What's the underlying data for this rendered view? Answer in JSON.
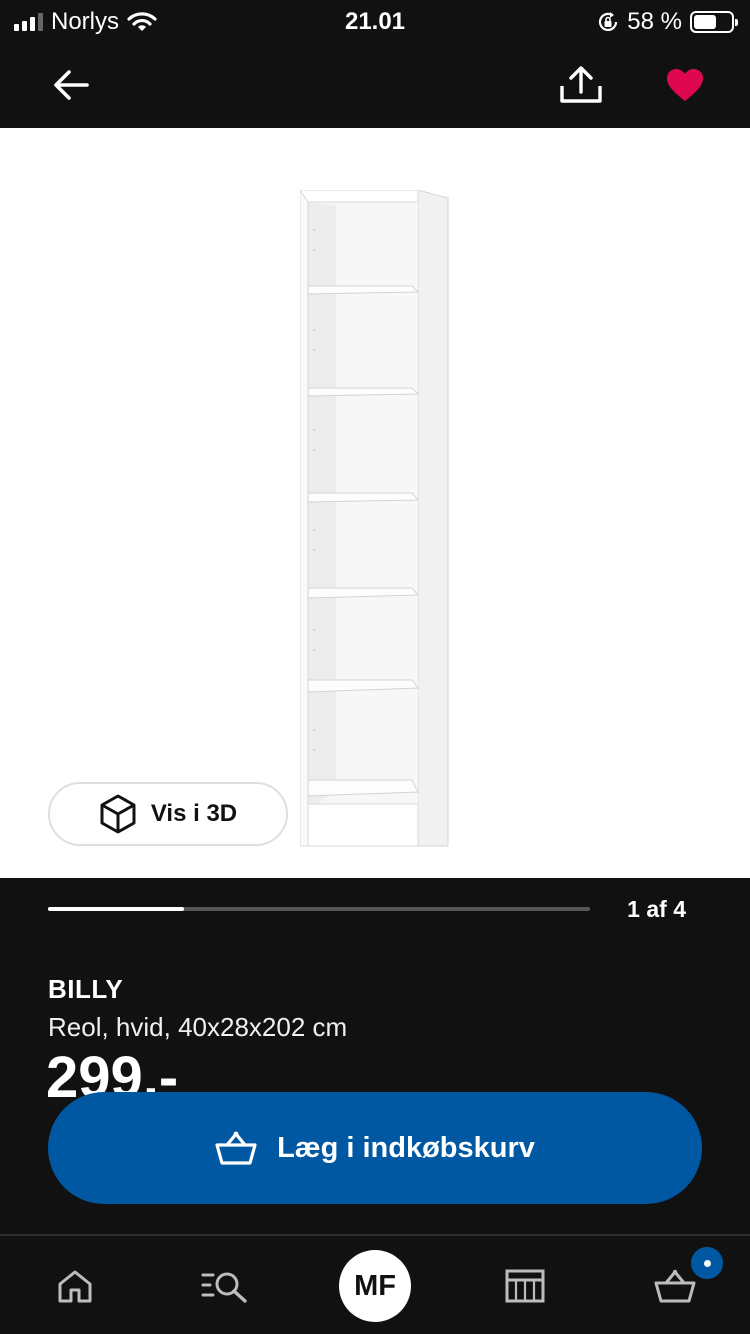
{
  "status_bar": {
    "carrier": "Norlys",
    "time": "21.01",
    "battery": "58 %",
    "icons": [
      "signal-icon",
      "wifi-icon",
      "rotation-lock-icon",
      "battery-icon"
    ]
  },
  "top_nav": {
    "icons": [
      "back-arrow-icon",
      "share-icon",
      "heart-icon"
    ],
    "favorite_color": "#e00751"
  },
  "image_viewer": {
    "view_3d_label": "Vis i 3D",
    "icon": "cube-3d-icon"
  },
  "carousel": {
    "page_indicator": "1 af 4",
    "current": 1,
    "total": 4
  },
  "product": {
    "name": "BILLY",
    "description": "Reol, hvid, 40x28x202 cm",
    "price": "299,-"
  },
  "cta": {
    "label": "Læg i indkøbskurv",
    "icon": "shopping-basket-icon",
    "color": "#0058a3"
  },
  "tab_bar": {
    "tabs": [
      {
        "name": "home",
        "icon": "home-icon"
      },
      {
        "name": "search",
        "icon": "search-icon"
      },
      {
        "name": "profile",
        "initials": "MF"
      },
      {
        "name": "store",
        "icon": "store-icon"
      },
      {
        "name": "cart",
        "icon": "shopping-basket-icon",
        "badge": true
      }
    ]
  }
}
